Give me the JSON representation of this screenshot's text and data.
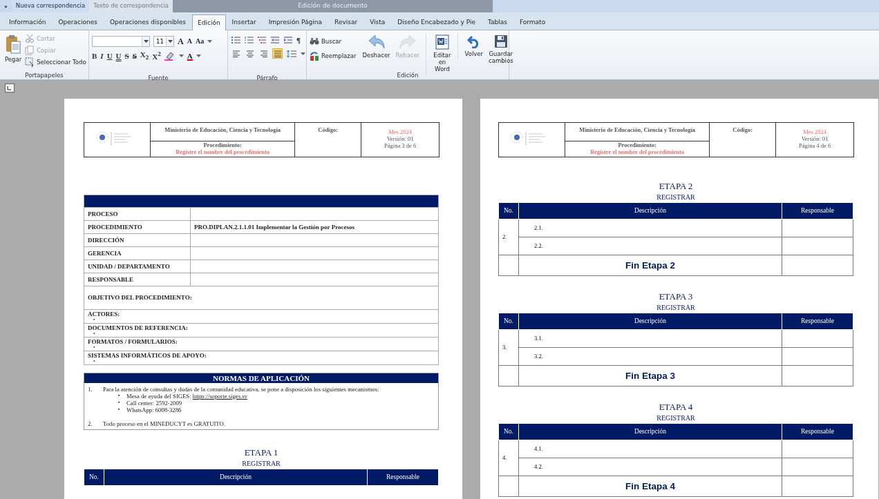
{
  "context_tabs": [
    {
      "label": "Nueva correspondencia",
      "disabled": false
    },
    {
      "label": "Texto de correspondencia",
      "disabled": true
    }
  ],
  "context_group": {
    "label": "Edición de documento"
  },
  "tabs": [
    {
      "label": "Información",
      "selected": false
    },
    {
      "label": "Operaciones",
      "selected": false
    },
    {
      "label": "Operaciones disponibles",
      "selected": false
    },
    {
      "label": "Edición",
      "selected": true
    },
    {
      "label": "Insertar",
      "selected": false
    },
    {
      "label": "Impresión Página",
      "selected": false
    },
    {
      "label": "Revisar",
      "selected": false
    },
    {
      "label": "Vista",
      "selected": false
    },
    {
      "label": "Diseño Encabezado y Pie",
      "selected": false
    },
    {
      "label": "Tablas",
      "selected": false
    },
    {
      "label": "Formato",
      "selected": false
    }
  ],
  "ribbon": {
    "clipboard": {
      "title": "Portapapeles",
      "paste": "Pegar",
      "actions": [
        {
          "kind": "cut",
          "label": "Cortar",
          "disabled": true
        },
        {
          "kind": "copy",
          "label": "Copiar",
          "disabled": true
        },
        {
          "kind": "select-all",
          "label": "Seleccionar Todo",
          "disabled": false
        }
      ]
    },
    "font": {
      "title": "Fuente",
      "font_size": "11",
      "size_buttons": [
        {
          "kind": "grow",
          "label": "A"
        },
        {
          "kind": "shrink",
          "label": "A"
        },
        {
          "kind": "case",
          "label": "Aa"
        }
      ],
      "format_buttons": [
        {
          "kind": "bold",
          "label": "B"
        },
        {
          "kind": "italic",
          "label": "I"
        },
        {
          "kind": "underline",
          "label": "U"
        },
        {
          "kind": "double-underline",
          "label": "U"
        },
        {
          "kind": "strike",
          "label": "S"
        },
        {
          "kind": "double-strike",
          "label": "S"
        },
        {
          "kind": "subscript",
          "label": "X$_{2}$"
        },
        {
          "kind": "superscript",
          "label": "X$^{2}$"
        }
      ],
      "color_label": "A"
    },
    "paragraph": {
      "title": "Párrafo",
      "pilcrow": "¶",
      "list_buttons": [
        {
          "kind": "bullets"
        },
        {
          "kind": "numbering"
        },
        {
          "kind": "multilevel"
        },
        {
          "kind": "outdent"
        },
        {
          "kind": "indent"
        }
      ],
      "alignment": [
        {
          "kind": "left",
          "selected": false
        },
        {
          "kind": "center",
          "selected": false
        },
        {
          "kind": "right",
          "selected": false
        },
        {
          "kind": "justify",
          "selected": true
        }
      ]
    },
    "editing": {
      "title": "Edición",
      "small": [
        {
          "kind": "find",
          "label": "Buscar"
        },
        {
          "kind": "replace",
          "label": "Reemplazar"
        }
      ],
      "large": [
        {
          "kind": "undo",
          "label": "Deshacer",
          "disabled": false
        },
        {
          "kind": "redo",
          "label": "Rehacer",
          "disabled": true
        },
        {
          "kind": "word",
          "label": "Editar en Word",
          "disabled": false
        },
        {
          "kind": "back",
          "label": "Volver",
          "disabled": false
        },
        {
          "kind": "save",
          "label": "Guardar cambios",
          "disabled": false
        }
      ]
    }
  },
  "pages": [
    {
      "header": {
        "ministry": "Ministerio de Educación, Ciencia y Tecnología",
        "procedure_label": "Procedimiento:",
        "procedure_name": "Registre el nombre del procedimiento",
        "code_label": "Código:",
        "date": "Mes 2024",
        "version": "Versión: 01",
        "page": "Página 3 de 6"
      },
      "blocks": [
        {
          "kind": "info",
          "rows": [
            {
              "label": "PROCESO"
            },
            {
              "label": "PROCEDIMIENTO",
              "value": "PRO.DIPLAN.2.1.1.01 Implementar la Gestión por Procesos"
            },
            {
              "label": "DIRECCIÓN"
            },
            {
              "label": "GERENCIA"
            },
            {
              "label": "UNIDAD / DEPARTAMENTO"
            },
            {
              "label": "RESPONSABLE"
            }
          ],
          "objective": "OBJETIVO DEL PROCEDIMIENTO:",
          "sections": [
            {
              "label": "ACTORES:",
              "bullet": "•"
            },
            {
              "label": "DOCUMENTOS DE REFERENCIA:",
              "bullet": "•"
            },
            {
              "label": "FORMATOS / FORMULARIOS:",
              "bullet": "•"
            },
            {
              "label": "SISTEMAS INFORMÁTICOS DE APOYO:",
              "bullet": "•"
            }
          ]
        },
        {
          "kind": "normas",
          "title": "NORMAS DE APLICACIÓN",
          "items": [
            {
              "number": "1.",
              "text": "Para la atención de consultas y dudas de la comunidad educativa, se pone a disposición los siguientes mecanismos:",
              "subitems": [
                {
                  "bullet": "▪",
                  "text": "Mesa de ayuda del SIGES: ",
                  "link": "https://soporte.siges.sv"
                },
                {
                  "bullet": "▪",
                  "text": "Call center: 2592-2009"
                },
                {
                  "bullet": "▪",
                  "text": "WhatsApp: 6008-3286"
                }
              ]
            },
            {
              "number": "2.",
              "text": "Todo proceso en el MINEDUCYT es GRATUITO."
            }
          ]
        },
        {
          "kind": "etapa",
          "title": "ETAPA 1",
          "subtitle": "REGISTRAR",
          "columns": [
            "No.",
            "Descripción",
            "Responsable"
          ]
        }
      ]
    },
    {
      "header": {
        "ministry": "Ministerio de Educación, Ciencia y Tecnología",
        "procedure_label": "Procedimiento:",
        "procedure_name": "Registre el nombre del procedimiento",
        "code_label": "Código:",
        "date": "Mes 2024",
        "version": "Versión: 01",
        "page": "Página 4 de 6"
      },
      "blocks": [
        {
          "kind": "etapa",
          "title": "ETAPA 2",
          "subtitle": "REGISTRAR",
          "columns": [
            "No.",
            "Descripción",
            "Responsable"
          ],
          "number": "2.",
          "rows": [
            "2.1.",
            "2.2."
          ],
          "end": "Fin Etapa 2"
        },
        {
          "kind": "etapa",
          "title": "ETAPA 3",
          "subtitle": "REGISTRAR",
          "columns": [
            "No.",
            "Descripción",
            "Responsable"
          ],
          "number": "3.",
          "rows": [
            "3.1.",
            "3.2."
          ],
          "end": "Fin Etapa 3"
        },
        {
          "kind": "etapa",
          "title": "ETAPA 4",
          "subtitle": "REGISTRAR",
          "columns": [
            "No.",
            "Descripción",
            "Responsable"
          ],
          "number": "4.",
          "rows": [
            "4.1.",
            "4.2."
          ],
          "end": "Fin Etapa 4"
        }
      ]
    }
  ]
}
